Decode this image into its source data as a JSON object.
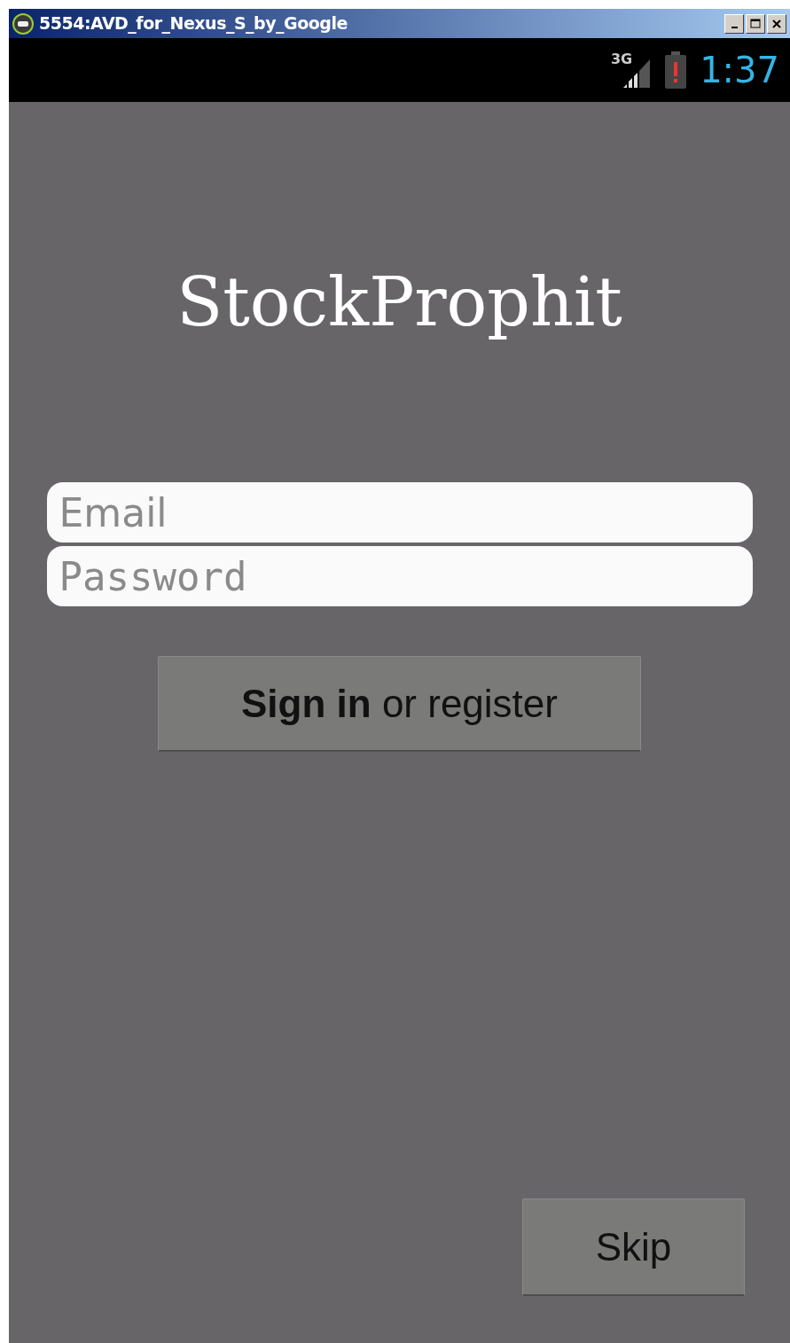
{
  "window": {
    "title": "5554:AVD_for_Nexus_S_by_Google"
  },
  "status_bar": {
    "network": "3G",
    "time": "1:37"
  },
  "app_title": "StockProphit",
  "fields": [
    {
      "kind": "text",
      "placeholder": "Email"
    },
    {
      "kind": "password",
      "placeholder": "Password"
    }
  ],
  "sign_in_button": "**Sign in** or register",
  "skip_button": "Skip"
}
